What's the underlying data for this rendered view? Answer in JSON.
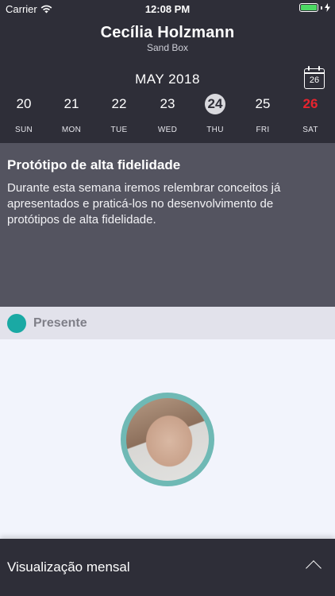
{
  "status_bar": {
    "carrier": "Carrier",
    "time": "12:08 PM",
    "wifi_icon": "wifi-icon",
    "battery_icon": "battery-icon",
    "charging_icon": "bolt-icon"
  },
  "header": {
    "name": "Cecília Holzmann",
    "workspace": "Sand Box",
    "month": "MAY 2018",
    "calendar_day": "26"
  },
  "week": [
    {
      "num": "20",
      "label": "SUN"
    },
    {
      "num": "21",
      "label": "MON"
    },
    {
      "num": "22",
      "label": "TUE"
    },
    {
      "num": "23",
      "label": "WED"
    },
    {
      "num": "24",
      "label": "THU"
    },
    {
      "num": "25",
      "label": "FRI"
    },
    {
      "num": "26",
      "label": "SAT"
    }
  ],
  "selected_day": "24",
  "highlighted_day": "26",
  "info": {
    "title": "Protótipo de alta fidelidade",
    "description": "Durante esta semana iremos relembrar conceitos já apresentados e praticá-los no desenvolvimento de protótipos de alta fidelidade."
  },
  "attendance": {
    "label": "Presente",
    "color": "#1aa9a4"
  },
  "footer": {
    "label": "Visualização mensal",
    "chevron_icon": "chevron-up-icon"
  },
  "colors": {
    "header_bg": "#2e2e38",
    "info_bg": "#545460",
    "weekend_red": "#e8242e",
    "present_teal": "#1aa9a4"
  }
}
